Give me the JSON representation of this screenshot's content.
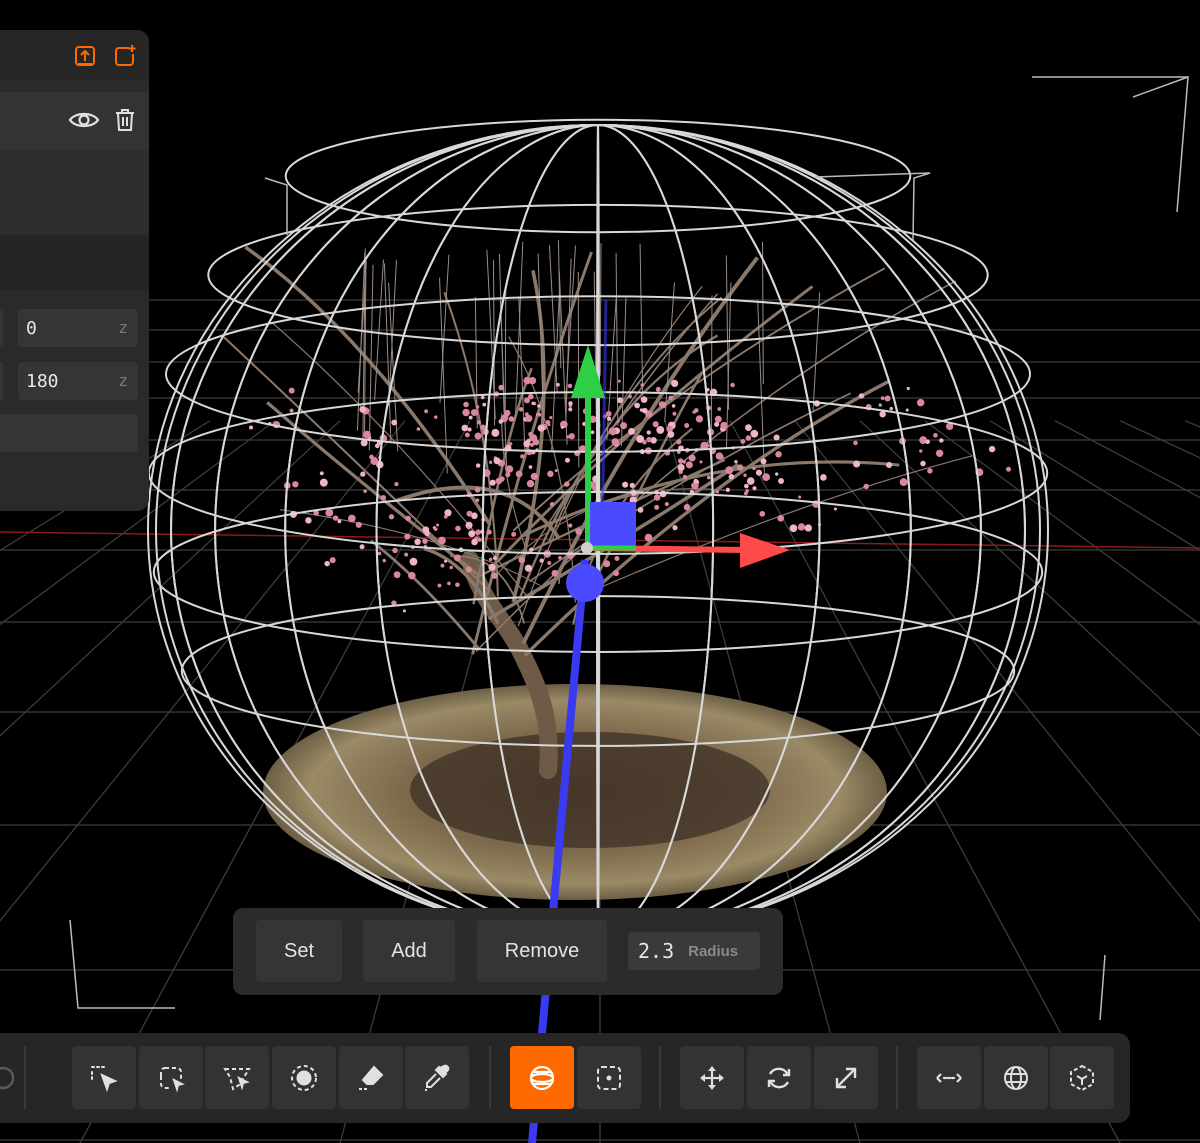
{
  "panel": {
    "header_icons": [
      "upload-icon",
      "add-file-icon"
    ],
    "row_icons": [
      "eye-icon",
      "trash-icon"
    ],
    "fields": [
      {
        "value": "0",
        "axis": "z"
      },
      {
        "value": "180",
        "axis": "z"
      }
    ]
  },
  "sphere_tool": {
    "set_label": "Set",
    "add_label": "Add",
    "remove_label": "Remove",
    "radius_value": "2.3",
    "radius_label": "Radius"
  },
  "toolbar": {
    "groups": [
      [
        "undo-icon"
      ],
      [
        "picker-select-icon",
        "lasso-select-icon",
        "polygon-select-icon",
        "brush-select-icon",
        "eraser-icon",
        "eyedropper-icon"
      ],
      [
        "sphere-select-icon",
        "box-select-icon"
      ],
      [
        "translate-icon",
        "rotate-icon",
        "scale-icon"
      ],
      [
        "world-space-toggle-icon",
        "globe-icon",
        "local-space-icon"
      ]
    ],
    "active_tool": "sphere-select-icon"
  },
  "colors": {
    "accent": "#ff6a00",
    "axis_x": "#ff4a4a",
    "axis_y": "#32d24a",
    "axis_z": "#4a4aff"
  }
}
